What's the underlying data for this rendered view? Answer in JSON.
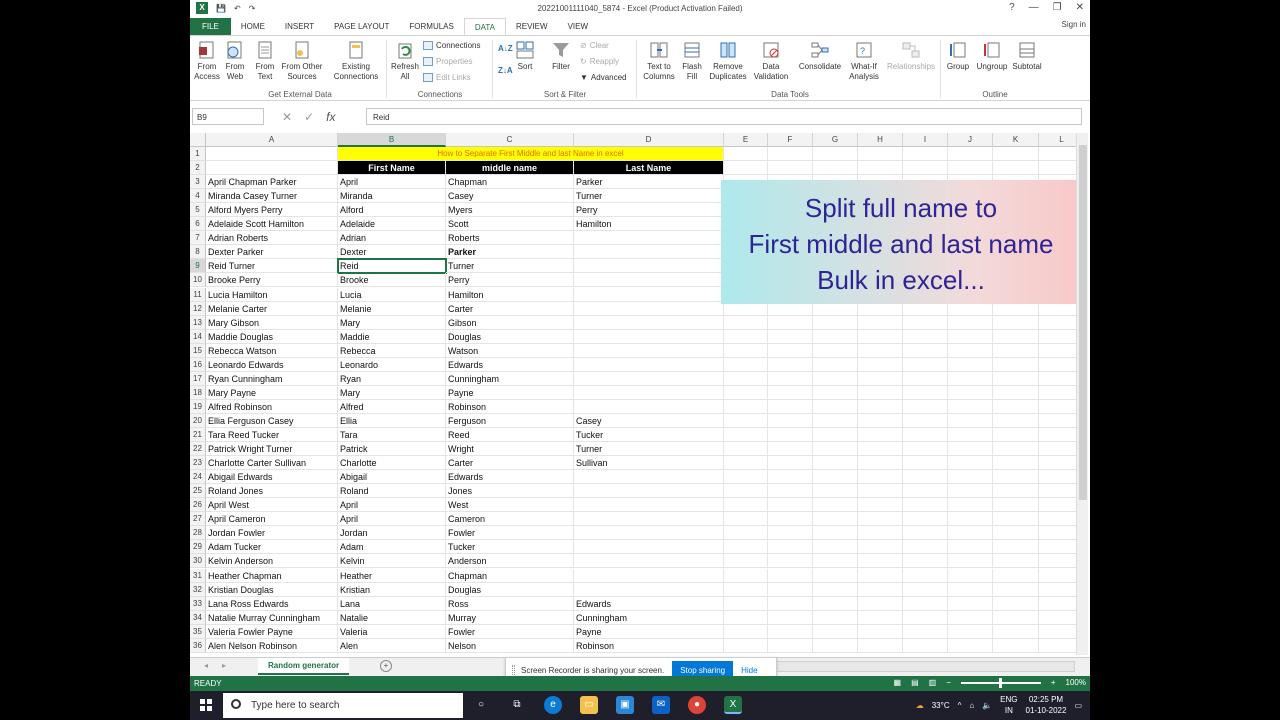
{
  "window": {
    "title": "20221001111040_5874 - Excel (Product Activation Failed)",
    "signin": "Sign in",
    "help": "?",
    "minimize": "—",
    "restore": "❐",
    "close": "✕"
  },
  "tabs": [
    "FILE",
    "HOME",
    "INSERT",
    "PAGE LAYOUT",
    "FORMULAS",
    "DATA",
    "REVIEW",
    "VIEW"
  ],
  "ribbon": {
    "from_access": "From\nAccess",
    "from_web": "From\nWeb",
    "from_text": "From\nText",
    "from_other": "From Other\nSources",
    "existing": "Existing\nConnections",
    "refresh": "Refresh\nAll",
    "connections": "Connections",
    "properties": "Properties",
    "edit_links": "Edit Links",
    "sort": "Sort",
    "filter": "Filter",
    "clear": "Clear",
    "reapply": "Reapply",
    "advanced": "Advanced",
    "text_to_columns": "Text to\nColumns",
    "flash_fill": "Flash\nFill",
    "remove_dup": "Remove\nDuplicates",
    "data_validation": "Data\nValidation",
    "consolidate": "Consolidate",
    "what_if": "What-If\nAnalysis",
    "relationships": "Relationships",
    "group": "Group",
    "ungroup": "Ungroup",
    "subtotal": "Subtotal",
    "group_get_external": "Get External Data",
    "group_connections": "Connections",
    "group_sort_filter": "Sort & Filter",
    "group_data_tools": "Data Tools",
    "group_outline": "Outline"
  },
  "formula_bar": {
    "name_box": "B9",
    "value": "Reid"
  },
  "columns": [
    "A",
    "B",
    "C",
    "D",
    "E",
    "F",
    "G",
    "H",
    "I",
    "J",
    "K",
    "L"
  ],
  "sheet": {
    "banner": "How to Separate First Middle and last Name in excel",
    "header_first": "First Name",
    "header_middle": "middle name",
    "header_last": "Last Name",
    "rows": [
      [
        "April Chapman Parker",
        "April",
        "Chapman",
        "Parker"
      ],
      [
        "Miranda Casey Turner",
        "Miranda",
        "Casey",
        "Turner"
      ],
      [
        "Alford Myers Perry",
        "Alford",
        "Myers",
        "Perry"
      ],
      [
        "Adelaide Scott Hamilton",
        "Adelaide",
        "Scott",
        "Hamilton"
      ],
      [
        "Adrian Roberts",
        "Adrian",
        "Roberts",
        ""
      ],
      [
        "Dexter Parker",
        "Dexter",
        "Parker",
        ""
      ],
      [
        "Reid Turner",
        "Reid",
        "Turner",
        ""
      ],
      [
        "Brooke Perry",
        "Brooke",
        "Perry",
        ""
      ],
      [
        "Lucia Hamilton",
        "Lucia",
        "Hamilton",
        ""
      ],
      [
        "Melanie Carter",
        "Melanie",
        "Carter",
        ""
      ],
      [
        "Mary Gibson",
        "Mary",
        "Gibson",
        ""
      ],
      [
        "Maddie Douglas",
        "Maddie",
        "Douglas",
        ""
      ],
      [
        "Rebecca Watson",
        "Rebecca",
        "Watson",
        ""
      ],
      [
        "Leonardo Edwards",
        "Leonardo",
        "Edwards",
        ""
      ],
      [
        "Ryan Cunningham",
        "Ryan",
        "Cunningham",
        ""
      ],
      [
        "Mary Payne",
        "Mary",
        "Payne",
        ""
      ],
      [
        "Alfred Robinson",
        "Alfred",
        "Robinson",
        ""
      ],
      [
        "Ellia Ferguson Casey",
        "Ellia",
        "Ferguson",
        "Casey"
      ],
      [
        "Tara Reed Tucker",
        "Tara",
        "Reed",
        "Tucker"
      ],
      [
        "Patrick Wright Turner",
        "Patrick",
        "Wright",
        "Turner"
      ],
      [
        "Charlotte Carter Sullivan",
        "Charlotte",
        "Carter",
        "Sullivan"
      ],
      [
        "Abigail Edwards",
        "Abigail",
        "Edwards",
        ""
      ],
      [
        "Roland Jones",
        "Roland",
        "Jones",
        ""
      ],
      [
        "April West",
        "April",
        "West",
        ""
      ],
      [
        "April Cameron",
        "April",
        "Cameron",
        ""
      ],
      [
        "Jordan Fowler",
        "Jordan",
        "Fowler",
        ""
      ],
      [
        "Adam Tucker",
        "Adam",
        "Tucker",
        ""
      ],
      [
        "Kelvin Anderson",
        "Kelvin",
        "Anderson",
        ""
      ],
      [
        "Heather Chapman",
        "Heather",
        "Chapman",
        ""
      ],
      [
        "Kristian Douglas",
        "Kristian",
        "Douglas",
        ""
      ],
      [
        "Lana Ross Edwards",
        "Lana",
        "Ross",
        "Edwards"
      ],
      [
        "Natalie Murray Cunningham",
        "Natalie",
        "Murray",
        "Cunningham"
      ],
      [
        "Valeria Fowler Payne",
        "Valeria",
        "Fowler",
        "Payne"
      ],
      [
        "Alen Nelson Robinson",
        "Alen",
        "Nelson",
        "Robinson"
      ]
    ]
  },
  "overlay": {
    "line1": "Split full name to",
    "line2": "First middle and last name",
    "line3": "Bulk in excel..."
  },
  "sheet_tab": "Random generator",
  "sharing": {
    "message": "Screen Recorder is sharing your screen.",
    "stop": "Stop sharing",
    "hide": "Hide"
  },
  "status": {
    "ready": "READY",
    "zoom": "100%"
  },
  "taskbar": {
    "search": "Type here to search",
    "weather": "33°C",
    "lang1": "ENG",
    "lang2": "IN",
    "time": "02:25 PM",
    "date": "01-10-2022"
  },
  "colors": {
    "excel_green": "#217346",
    "banner_yellow": "#ffff00",
    "banner_text": "#e46c0a",
    "overlay_text": "#2e2496"
  }
}
